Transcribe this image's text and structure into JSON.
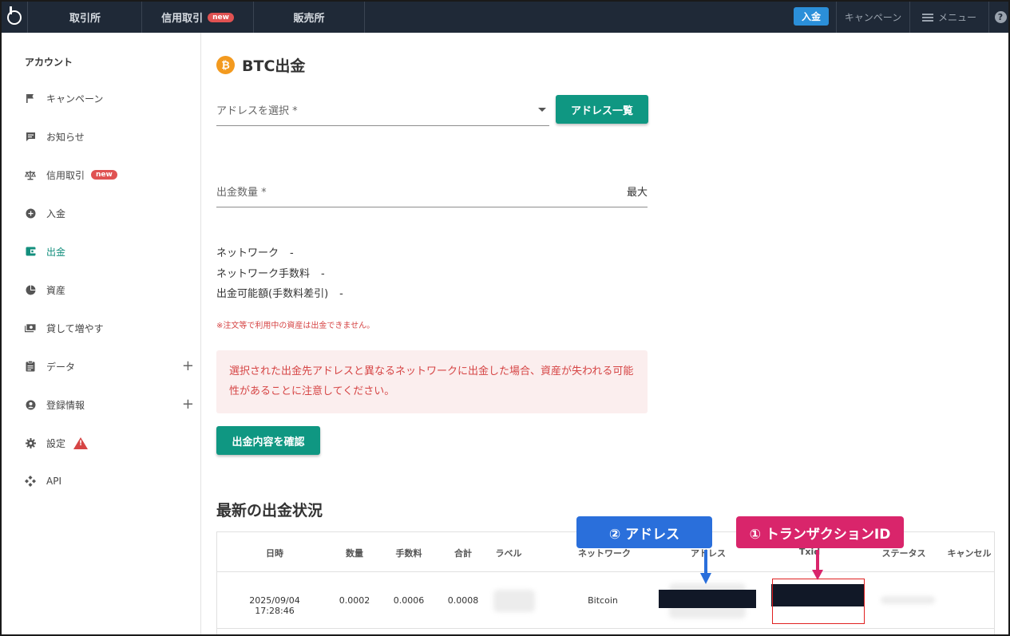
{
  "topnav": {
    "items": [
      {
        "label": "取引所"
      },
      {
        "label": "信用取引",
        "badge": "new"
      },
      {
        "label": "販売所"
      }
    ],
    "deposit_label": "入金",
    "campaign_label": "キャンペーン",
    "menu_label": "メニュー",
    "help_glyph": "?"
  },
  "sidebar": {
    "heading": "アカウント",
    "items": [
      {
        "label": "キャンペーン",
        "icon": "flag-icon"
      },
      {
        "label": "お知らせ",
        "icon": "message-icon"
      },
      {
        "label": "信用取引",
        "icon": "scale-icon",
        "badge": "new"
      },
      {
        "label": "入金",
        "icon": "plus-circle-icon"
      },
      {
        "label": "出金",
        "icon": "wallet-icon",
        "active": true
      },
      {
        "label": "資産",
        "icon": "pie-chart-icon"
      },
      {
        "label": "貸して増やす",
        "icon": "cash-icon"
      },
      {
        "label": "データ",
        "icon": "clipboard-icon",
        "expand": "+"
      },
      {
        "label": "登録情報",
        "icon": "account-icon",
        "expand": "+"
      },
      {
        "label": "設定",
        "icon": "gear-icon",
        "warning": "!"
      },
      {
        "label": "API",
        "icon": "api-icon"
      }
    ]
  },
  "main": {
    "title": "BTC出金",
    "btc_glyph": "₿",
    "address_select_label": "アドレスを選択 *",
    "address_list_button": "アドレス一覧",
    "amount_label": "出金数量 *",
    "max_label": "最大",
    "info": [
      {
        "label": "ネットワーク",
        "value": "-"
      },
      {
        "label": "ネットワーク手数料",
        "value": "-"
      },
      {
        "label": "出金可能額(手数料差引)",
        "value": "-"
      }
    ],
    "note": "※注文等で利用中の資産は出金できません。",
    "alert_text": "選択された出金先アドレスと異なるネットワークに出金した場合、資産が失われる可能性があることに注意してください。",
    "confirm_button": "出金内容を確認",
    "history_title": "最新の出金状況"
  },
  "table": {
    "headers": [
      "日時",
      "数量",
      "手数料",
      "合計",
      "ラベル",
      "ネットワーク",
      "アドレス",
      "Txid",
      "ステータス",
      "キャンセル"
    ],
    "rows": [
      {
        "datetime": "2025/09/04 17:28:46",
        "quantity": "0.0002",
        "fee": "0.0006",
        "total": "0.0008",
        "network": "Bitcoin"
      }
    ]
  },
  "annotations": {
    "address_callout": "② アドレス",
    "txid_callout": "① トランザクションID",
    "address_color": "#2a6fdb",
    "txid_color": "#d9256b"
  },
  "colors": {
    "nav_bg": "#1f2937",
    "accent_green": "#0f9782",
    "deposit_blue": "#2b8fd9",
    "badge_red": "#e05252",
    "btc_orange": "#f39a1f",
    "alert_bg": "#fbeeee",
    "alert_text": "#d64545"
  }
}
